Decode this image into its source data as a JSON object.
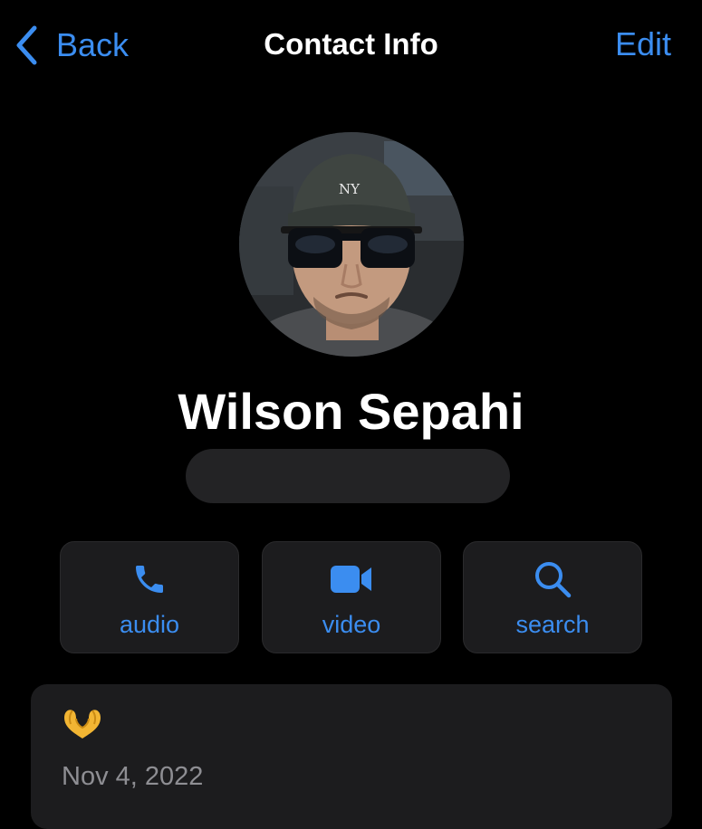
{
  "nav": {
    "back_label": "Back",
    "title": "Contact Info",
    "edit_label": "Edit"
  },
  "contact": {
    "name": "Wilson Sepahi"
  },
  "actions": [
    {
      "label": "audio",
      "icon": "phone-icon"
    },
    {
      "label": "video",
      "icon": "video-camera-icon"
    },
    {
      "label": "search",
      "icon": "magnifier-icon"
    }
  ],
  "about": {
    "emoji": "heart-hands-emoji",
    "date": "Nov 4, 2022"
  },
  "colors": {
    "accent": "#3b8df0",
    "background": "#000000",
    "card": "#1c1c1e",
    "secondary_text": "#8e8e93"
  }
}
